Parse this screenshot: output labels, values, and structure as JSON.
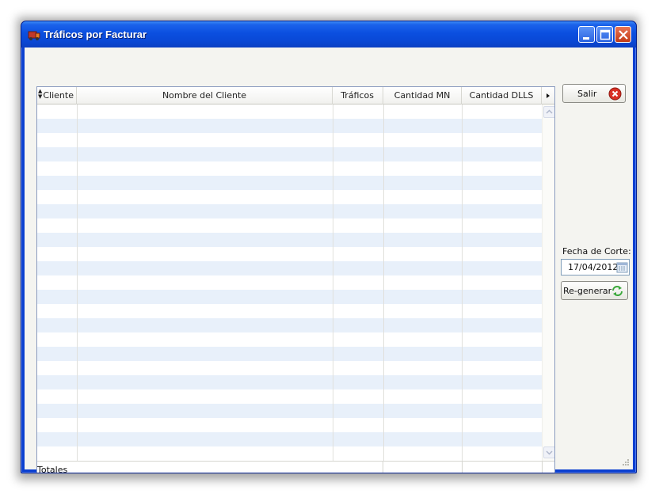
{
  "window": {
    "title": "Tráficos por Facturar"
  },
  "grid": {
    "columns": [
      {
        "label": "Cliente"
      },
      {
        "label": "Nombre del Cliente"
      },
      {
        "label": "Tráficos"
      },
      {
        "label": "Cantidad MN"
      },
      {
        "label": "Cantidad DLLS"
      }
    ],
    "rows": [],
    "totals_label": "Totales"
  },
  "actions": {
    "exit_label": "Salir",
    "cutoff_label": "Fecha de Corte:",
    "cutoff_date": "17/04/2012",
    "regenerate_label": "Re-generar"
  },
  "colors": {
    "titlebar": "#0b4fe0",
    "alt_row": "#e8f0fa",
    "close_icon": "#d93025",
    "refresh_icon": "#3aa83a"
  }
}
